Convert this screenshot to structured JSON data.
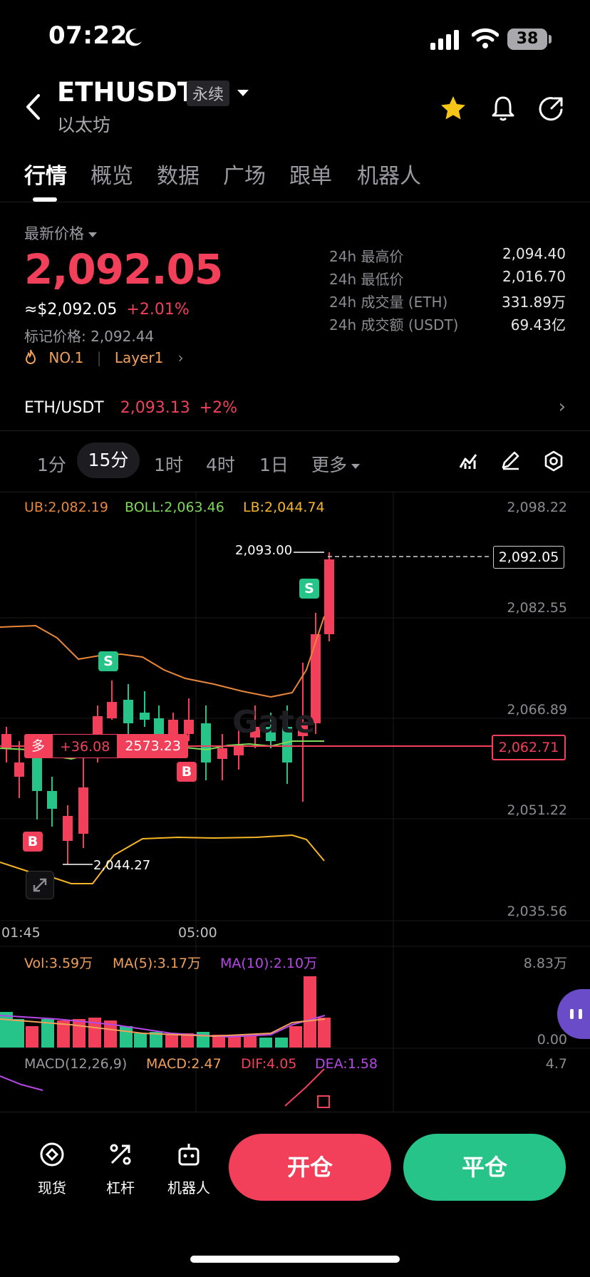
{
  "status": {
    "time": "07:22",
    "battery": "38"
  },
  "header": {
    "symbol": "ETHUSDT",
    "contract_badge": "永续",
    "name": "以太坊"
  },
  "tabs": [
    "行情",
    "概览",
    "数据",
    "广场",
    "跟单",
    "机器人"
  ],
  "price": {
    "label": "最新价格",
    "last": "2,092.05",
    "usd": "≈$2,092.05",
    "change": "+2.01%",
    "mark": "标记价格: 2,092.44",
    "rank": "NO.1",
    "sector": "Layer1"
  },
  "stats": [
    {
      "label": "24h 最高价",
      "value": "2,094.40"
    },
    {
      "label": "24h 最低价",
      "value": "2,016.70"
    },
    {
      "label": "24h 成交量 (ETH)",
      "value": "331.89万"
    },
    {
      "label": "24h 成交额 (USDT)",
      "value": "69.43亿"
    }
  ],
  "spot": {
    "pair": "ETH/USDT",
    "price": "2,093.13",
    "change": "+2%"
  },
  "timeframes": [
    "1分",
    "15分",
    "1时",
    "4时",
    "1日",
    "更多"
  ],
  "indicators": {
    "ub": "UB:2,082.19",
    "boll": "BOLL:2,063.46",
    "lb": "LB:2,044.74",
    "vol": "Vol:3.59万",
    "ma5": "MA(5):3.17万",
    "ma10": "MA(10):2.10万",
    "macd_name": "MACD(12,26,9)",
    "macd": "MACD:2.47",
    "dif": "DIF:4.05",
    "dea": "DEA:1.58"
  },
  "yaxis": [
    "2,098.22",
    "2,082.55",
    "2,066.89",
    "2,051.22",
    "2,035.56"
  ],
  "vol_axis": [
    "8.83万",
    "0.00"
  ],
  "macd_axis": "4.7",
  "time_axis": [
    "01:45",
    "05:00"
  ],
  "chart_labels": {
    "high": "2,093.00",
    "low": "2,044.27",
    "current": "2,092.05",
    "position_side": "多",
    "position_pnl": "+36.08",
    "position_entry": "2573.23",
    "position_line": "2,062.71",
    "watermark": "Gate",
    "sell_marker": "S",
    "buy_marker": "B"
  },
  "colors": {
    "up": "#f2405a",
    "down": "#27c48a",
    "ub": "#e8873a",
    "boll": "#7ed958",
    "lb": "#f5b526",
    "ma10": "#b648e8"
  },
  "bottom_nav": [
    "现货",
    "杠杆",
    "机器人"
  ],
  "actions": {
    "open": "开仓",
    "close": "平仓"
  }
}
